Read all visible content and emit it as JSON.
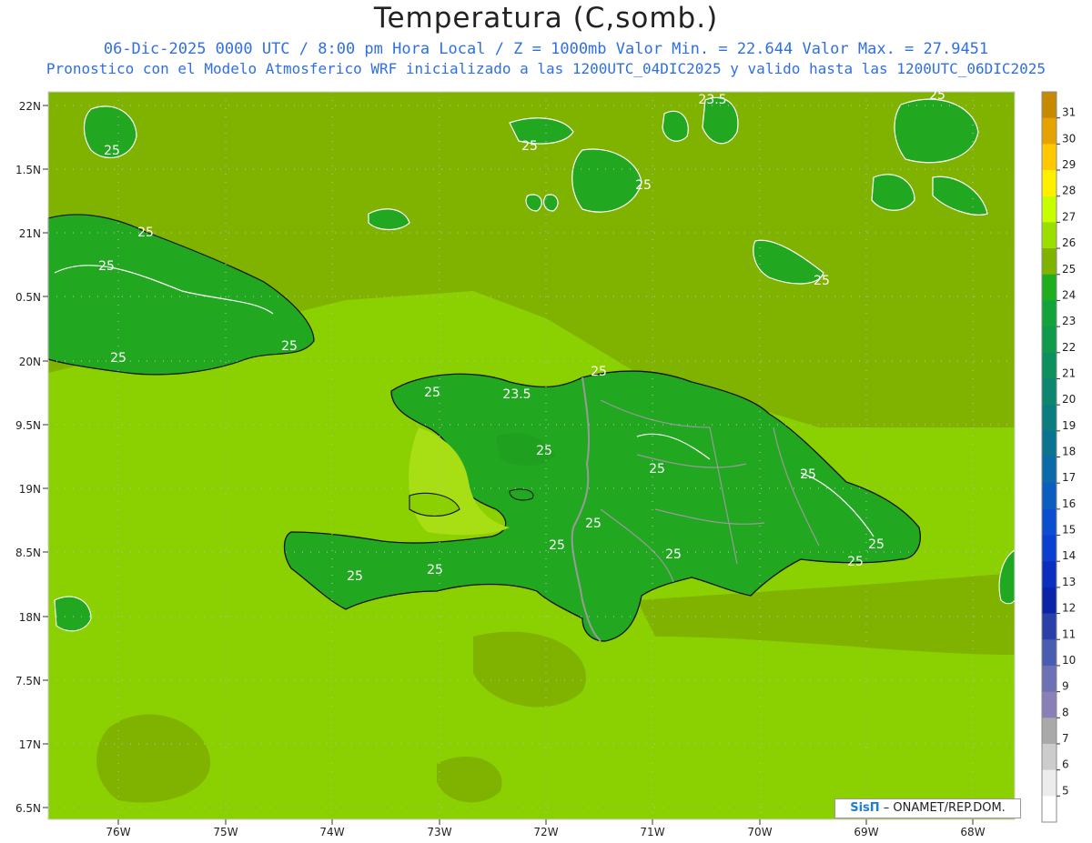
{
  "title": "Temperatura (C,somb.)",
  "subtitle_line1": "06-Dic-2025  0000 UTC / 8:00 pm Hora Local / Z = 1000mb    Valor Min. = 22.644  Valor Max. = 27.9451",
  "subtitle_line2": "Pronostico con el Modelo Atmosferico WRF inicializado a las 1200UTC_04DIC2025 y valido hasta las  1200UTC_06DIC2025",
  "credit": {
    "logo": "SisΠ",
    "text": " – ONAMET/REP.DOM."
  },
  "lat_labels": [
    "22N",
    "1.5N",
    "21N",
    "0.5N",
    "20N",
    "9.5N",
    "19N",
    "8.5N",
    "18N",
    "7.5N",
    "17N",
    "6.5N"
  ],
  "lon_labels": [
    "76W",
    "75W",
    "74W",
    "73W",
    "72W",
    "71W",
    "70W",
    "69W",
    "68W"
  ],
  "colorbar": {
    "ticks": [
      "31",
      "30",
      "29",
      "28",
      "27",
      "26",
      "25",
      "24",
      "23",
      "22",
      "21",
      "20",
      "19",
      "18",
      "17",
      "16",
      "15",
      "14",
      "13",
      "12",
      "11",
      "10",
      "9",
      "8",
      "7",
      "6",
      "5"
    ],
    "colors": [
      "#c58a00",
      "#e6a300",
      "#ffc800",
      "#fff000",
      "#c8ff00",
      "#9bdf00",
      "#7fb300",
      "#1fae1f",
      "#12a43a",
      "#0f9a4c",
      "#0e905e",
      "#0d8670",
      "#0b7d80",
      "#0a7490",
      "#0b6aa8",
      "#0b5ebf",
      "#0b4fcf",
      "#0a3fd0",
      "#0a2fbf",
      "#0a24a8",
      "#2b3fa8",
      "#4a5cb0",
      "#6c70b5",
      "#8b7fb8",
      "#a9a9a9",
      "#cccccc",
      "#ececec",
      "#ffffff"
    ]
  },
  "contour_labels": [
    {
      "text": "25"
    },
    {
      "text": "25"
    },
    {
      "text": "25"
    },
    {
      "text": "25"
    },
    {
      "text": "25"
    },
    {
      "text": "25"
    },
    {
      "text": "23.5"
    },
    {
      "text": "25"
    },
    {
      "text": "25"
    },
    {
      "text": "25"
    },
    {
      "text": "25"
    },
    {
      "text": "25"
    },
    {
      "text": "25"
    },
    {
      "text": "25"
    },
    {
      "text": "25"
    },
    {
      "text": "25"
    },
    {
      "text": "25"
    },
    {
      "text": "25"
    },
    {
      "text": "25"
    },
    {
      "text": "25"
    },
    {
      "text": "23.5"
    },
    {
      "text": "25"
    },
    {
      "text": "25"
    }
  ],
  "colors": {
    "sea": "#7fb300",
    "warm_sea": "#8bc800",
    "land": "#21a820",
    "hot": "#b2e61e",
    "contour": "#ffffff",
    "coast": "#111111",
    "border": "#9a9a9a"
  }
}
